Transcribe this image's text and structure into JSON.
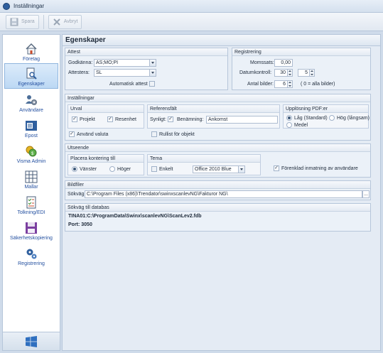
{
  "window": {
    "title": "Inställningar"
  },
  "toolbar": {
    "save_label": "Spara",
    "cancel_label": "Avbryt"
  },
  "sidebar": {
    "items": [
      {
        "label": "Företag",
        "icon": "home-icon"
      },
      {
        "label": "Egenskaper",
        "icon": "document-search-icon"
      },
      {
        "label": "Användare",
        "icon": "users-gear-icon"
      },
      {
        "label": "Epost",
        "icon": "mail-icon"
      },
      {
        "label": "Visma Admin",
        "icon": "coins-icon"
      },
      {
        "label": "Mallar",
        "icon": "grid-template-icon"
      },
      {
        "label": "Tolkning/EDI",
        "icon": "checklist-icon"
      },
      {
        "label": "Säkerhetskopiering",
        "icon": "floppy-icon"
      },
      {
        "label": "Registrering",
        "icon": "gears-icon"
      }
    ],
    "footer_icon": "windows-logo-icon"
  },
  "main": {
    "title": "Egenskaper",
    "attest": {
      "title": "Attest",
      "godkanna_label": "Godkänna:",
      "godkanna_value": "AS;MO;PI",
      "attestera_label": "Attestera:",
      "attestera_value": "SL",
      "auto_attest_label": "Automatisk attest"
    },
    "registrering": {
      "title": "Registrering",
      "momssats_label": "Momssats:",
      "momssats_value": "0,00",
      "datumkontroll_label": "Datumkontroll:",
      "datumkontroll_value1": "30",
      "datumkontroll_value2": "5",
      "antal_bilder_label": "Antal bilder:",
      "antal_bilder_value": "6",
      "antal_bilder_note": "( 0 = alla bilder)"
    },
    "installningar": {
      "title": "Inställningar",
      "urval": {
        "title": "Urval",
        "projekt_label": "Projekt",
        "resenhet_label": "Resenhet"
      },
      "referensfalt": {
        "title": "Referensfält",
        "synligt_label": "Synligt:",
        "benamning_label": "Benämning:",
        "benamning_value": "Ankomst"
      },
      "upplosning": {
        "title": "Upplösning PDF:er",
        "lag_label": "Låg (Standard)",
        "hog_label": "Hög (långsam)",
        "medel_label": "Medel"
      },
      "anvand_valuta_label": "Använd valuta",
      "rullist_label": "Rullist för objekt"
    },
    "utseende": {
      "title": "Utseende",
      "placera": {
        "title": "Placera kontering till",
        "vanster_label": "Vänster",
        "hoger_label": "Höger"
      },
      "tema": {
        "title": "Tema",
        "enkelt_label": "Enkelt",
        "theme_value": "Office 2010 Blue"
      },
      "forenklad_label": "Förenklad inmatning av användare"
    },
    "bildfiler": {
      "title": "Bildfiler",
      "sokvag_label": "Sökväg:",
      "sokvag_value": "C:\\Program Files (x86)\\Trendator\\swinxscanlevNG\\Fakturor NG\\",
      "browse_label": "..."
    },
    "databas": {
      "title": "Sökväg till databas",
      "path": "TINA01:C:\\ProgramData\\Swinx\\scanlevNG\\ScanLev2.fdb",
      "port": "Port: 3050"
    }
  }
}
